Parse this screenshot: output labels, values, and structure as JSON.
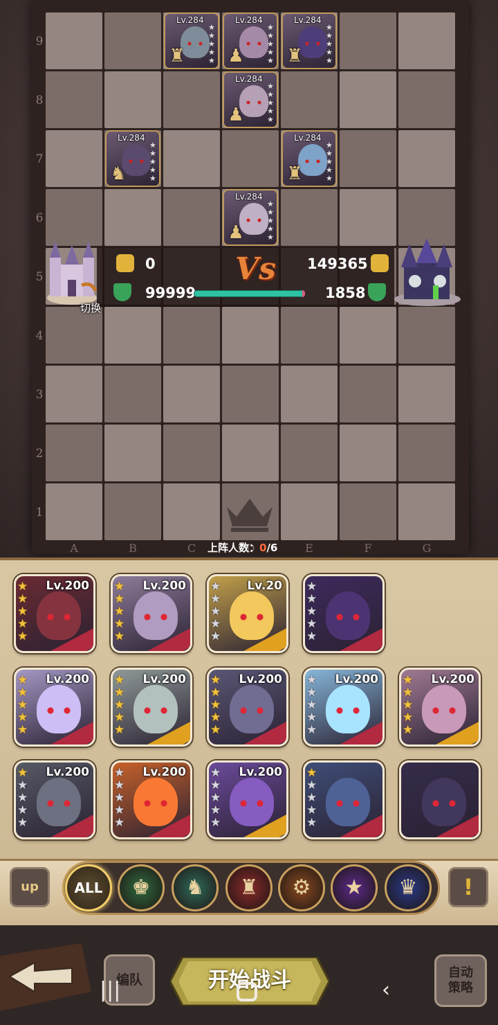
{
  "board": {
    "row_labels": [
      "9",
      "8",
      "7",
      "6",
      "5",
      "4",
      "3",
      "2",
      "1"
    ],
    "col_labels": [
      "A",
      "B",
      "C",
      "D",
      "E",
      "F",
      "G"
    ],
    "enemy_units": [
      {
        "level": "Lv.284",
        "piece_icon": "cannon-icon",
        "color": "#7e8c99"
      },
      {
        "level": "Lv.284",
        "piece_icon": "pawn-icon",
        "color": "#a58aa8"
      },
      {
        "level": "Lv.284",
        "piece_icon": "cannon-icon",
        "color": "#4d3d78"
      },
      {
        "level": "Lv.284",
        "piece_icon": "pawn-icon",
        "color": "#b6a0b5"
      },
      {
        "level": "Lv.284",
        "piece_icon": "knight-icon",
        "color": "#5a4a6e"
      },
      {
        "level": "Lv.284",
        "piece_icon": "chariot-icon",
        "color": "#7ea2c8"
      },
      {
        "level": "Lv.284",
        "piece_icon": "pawn-icon",
        "color": "#c0b0c6"
      }
    ],
    "switch_label": "切换",
    "deploy_label": "上阵人数：",
    "deploy_count": "0",
    "deploy_max": "/6"
  },
  "vs": {
    "label": "Vs",
    "left_power": "0",
    "left_hp": "99999",
    "right_power": "149365",
    "right_hp": "1858",
    "hp_fill_pct": 98
  },
  "roster": [
    {
      "level": "Lv.200",
      "gold_stars": 5,
      "silver_stars": 0,
      "color": "#6a2a32"
    },
    {
      "level": "Lv.200",
      "gold_stars": 5,
      "silver_stars": 0,
      "color": "#8d7c9a"
    },
    {
      "level": "Lv.20",
      "gold_stars": 0,
      "silver_stars": 5,
      "color": "#c2a04a"
    },
    {
      "level": "",
      "gold_stars": 0,
      "silver_stars": 5,
      "color": "#3d2a5c"
    },
    {
      "level": "Lv.200",
      "gold_stars": 5,
      "silver_stars": 0,
      "color": "#a498c4"
    },
    {
      "level": "Lv.200",
      "gold_stars": 5,
      "silver_stars": 0,
      "color": "#8f9a98"
    },
    {
      "level": "Lv.200",
      "gold_stars": 5,
      "silver_stars": 0,
      "color": "#5a5675"
    },
    {
      "level": "Lv.200",
      "gold_stars": 0,
      "silver_stars": 5,
      "color": "#86b6d9"
    },
    {
      "level": "Lv.200",
      "gold_stars": 5,
      "silver_stars": 0,
      "color": "#a07a93"
    },
    {
      "level": "Lv.200",
      "gold_stars": 1,
      "silver_stars": 4,
      "color": "#565a66"
    },
    {
      "level": "Lv.200",
      "gold_stars": 0,
      "silver_stars": 5,
      "color": "#c7612a"
    },
    {
      "level": "Lv.200",
      "gold_stars": 0,
      "silver_stars": 5,
      "color": "#6b4a9a"
    },
    {
      "level": "",
      "gold_stars": 1,
      "silver_stars": 4,
      "color": "#3f4e78"
    },
    {
      "level": "",
      "gold_stars": 0,
      "silver_stars": 0,
      "color": "#352c4a"
    }
  ],
  "tabs": [
    {
      "label": "ALL",
      "icon": "all-icon"
    },
    {
      "label": "",
      "icon": "warrior-icon"
    },
    {
      "label": "",
      "icon": "knight-icon"
    },
    {
      "label": "",
      "icon": "cannon-icon"
    },
    {
      "label": "",
      "icon": "chariot-icon"
    },
    {
      "label": "",
      "icon": "mage-icon"
    },
    {
      "label": "",
      "icon": "queen-icon"
    }
  ],
  "buttons": {
    "up": "up",
    "info": "!",
    "team": "编队",
    "start": "开始战斗",
    "auto_line1": "自动",
    "auto_line2": "策略"
  }
}
